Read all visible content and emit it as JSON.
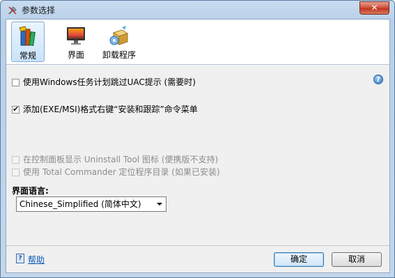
{
  "window": {
    "title": "参数选择",
    "close_label": "✕"
  },
  "toolbar": {
    "items": [
      {
        "label": "常规",
        "icon": "books-icon",
        "active": true
      },
      {
        "label": "界面",
        "icon": "monitor-icon",
        "active": false
      },
      {
        "label": "卸载程序",
        "icon": "uninstall-box-icon",
        "active": false
      }
    ]
  },
  "options": {
    "skip_uac": {
      "label": "使用Windows任务计划跳过UAC提示 (需要时)",
      "checked": false,
      "enabled": true
    },
    "context_menu": {
      "label": "添加(EXE/MSI)格式右键“安装和跟踪”命令菜单",
      "checked": true,
      "enabled": true
    },
    "control_panel": {
      "label": "在控制面板显示 Uninstall Tool 图标 (便携版不支持)",
      "checked": false,
      "enabled": false
    },
    "total_commander": {
      "label": "使用 Total Commander 定位程序目录 (如果已安装)",
      "checked": false,
      "enabled": false
    }
  },
  "language": {
    "label": "界面语言:",
    "selected": "Chinese_Simplified (简体中文)"
  },
  "footer": {
    "help_label": "帮助",
    "ok_label": "确定",
    "cancel_label": "取消"
  },
  "colors": {
    "link": "#0c57b8",
    "close_button": "#c0361f",
    "selection_border": "#84acd7"
  }
}
